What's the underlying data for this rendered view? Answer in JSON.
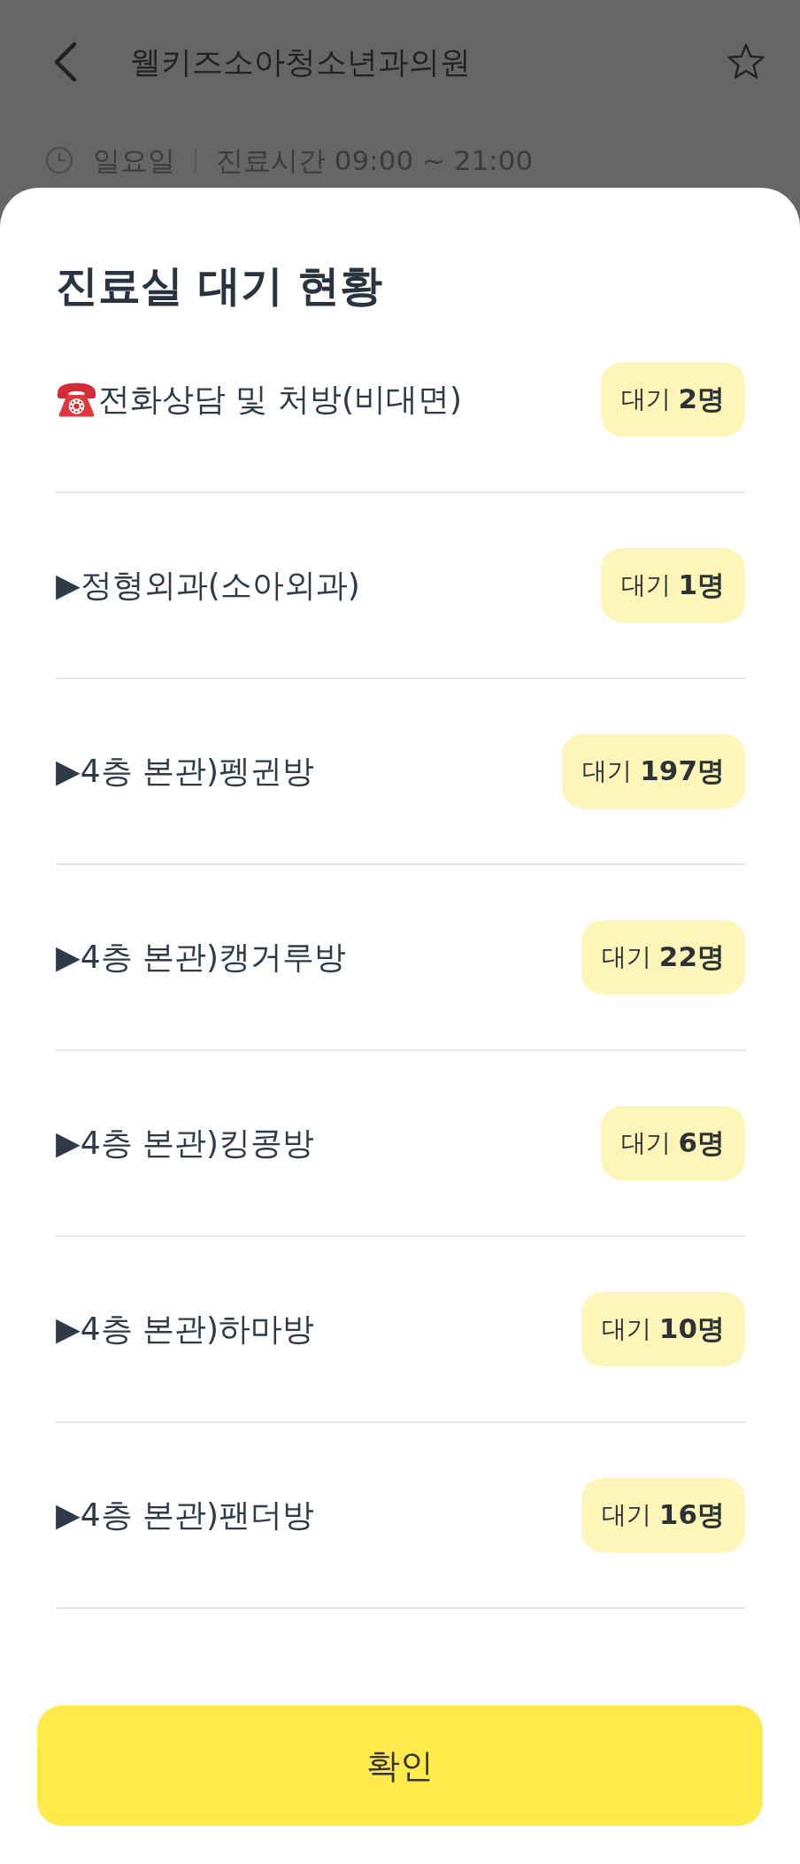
{
  "header": {
    "title": "웰키즈소아청소년과의원",
    "favorite": false
  },
  "hours": {
    "day": "일요일",
    "time": "진료시간 09:00 ~ 21:00"
  },
  "sheet": {
    "title": "진료실 대기 현황",
    "rooms": [
      {
        "kind": "phone",
        "name": "전화상담 및 처방(비대면)",
        "waiting": "대기 **2명**"
      },
      {
        "kind": "plain",
        "name": "▶정형외과(소아외과)",
        "waiting": "대기 **1명**"
      },
      {
        "kind": "plain",
        "name": "▶4층 본관)펭귄방",
        "waiting": "대기 **197명**"
      },
      {
        "kind": "plain",
        "name": "▶4층 본관)캥거루방",
        "waiting": "대기 **22명**"
      },
      {
        "kind": "plain",
        "name": "▶4층 본관)킹콩방",
        "waiting": "대기 **6명**"
      },
      {
        "kind": "plain",
        "name": "▶4층 본관)하마방",
        "waiting": "대기 **10명**"
      },
      {
        "kind": "plain",
        "name": "▶4층 본관)팬더방",
        "waiting": "대기 **16명**"
      }
    ],
    "confirm_button": "확인"
  }
}
